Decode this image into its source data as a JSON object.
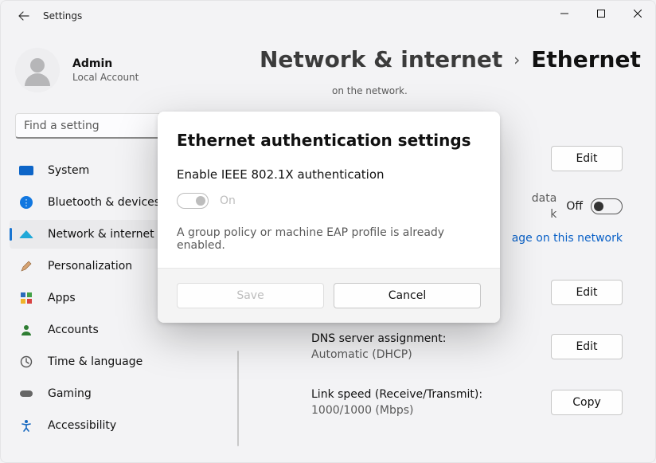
{
  "window": {
    "title": "Settings"
  },
  "user": {
    "name": "Admin",
    "subtitle": "Local Account"
  },
  "search": {
    "placeholder": "Find a setting"
  },
  "sidebar": [
    {
      "id": "system",
      "label": "System"
    },
    {
      "id": "bluetooth",
      "label": "Bluetooth & devices"
    },
    {
      "id": "network",
      "label": "Network & internet",
      "selected": true
    },
    {
      "id": "personalization",
      "label": "Personalization"
    },
    {
      "id": "apps",
      "label": "Apps"
    },
    {
      "id": "accounts",
      "label": "Accounts"
    },
    {
      "id": "time",
      "label": "Time & language"
    },
    {
      "id": "gaming",
      "label": "Gaming"
    },
    {
      "id": "accessibility",
      "label": "Accessibility"
    }
  ],
  "breadcrumb": {
    "parent": "Network & internet",
    "separator": "›",
    "current": "Ethernet"
  },
  "page": {
    "top_fragment": "on the network.",
    "authentication": {
      "button": "Edit"
    },
    "metered": {
      "hint_line1": "data",
      "hint_line2": "k",
      "off_label": "Off",
      "link_fragment": "age on this network"
    },
    "ip": {
      "button": "Edit"
    },
    "dns": {
      "label": "DNS server assignment:",
      "value": "Automatic (DHCP)",
      "button": "Edit"
    },
    "link_speed": {
      "label": "Link speed (Receive/Transmit):",
      "value": "1000/1000 (Mbps)",
      "button": "Copy"
    }
  },
  "modal": {
    "title": "Ethernet authentication settings",
    "setting_label": "Enable IEEE 802.1X authentication",
    "toggle_state": "On",
    "toggle_enabled": false,
    "help_text": "A group policy or machine EAP profile is already enabled.",
    "save_label": "Save",
    "save_enabled": false,
    "cancel_label": "Cancel"
  }
}
